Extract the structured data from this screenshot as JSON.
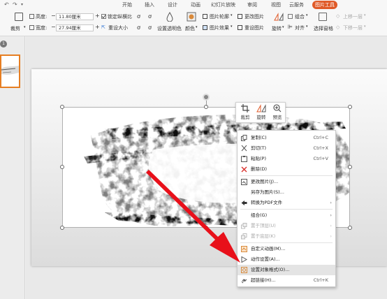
{
  "titlebar": {
    "quick_access": [
      "↶",
      "↷",
      "▾"
    ]
  },
  "tabs": [
    {
      "label": "开始"
    },
    {
      "label": "插入"
    },
    {
      "label": "设计"
    },
    {
      "label": "动画"
    },
    {
      "label": "幻灯片放映"
    },
    {
      "label": "审阅"
    },
    {
      "label": "视图"
    },
    {
      "label": "云服务"
    },
    {
      "label": "图片工具"
    }
  ],
  "ribbon": {
    "crop_label": "裁剪",
    "height_label": "高度:",
    "height_value": "11.80厘米",
    "width_label": "宽度:",
    "width_value": "27.94厘米",
    "lock_ratio_label": "锁定纵横比",
    "reset_size_label": "重设大小",
    "transparent_label": "设置透明色",
    "color_label": "颜色",
    "outline_label": "图片轮廓",
    "effect_label": "图片效果",
    "change_picture_label": "更改图片",
    "reset_picture_label": "重设图片",
    "rotate_label": "旋转",
    "group_label": "组合",
    "align_label": "对齐",
    "selection_pane_label": "选择窗格",
    "bring_forward_label": "上移一层",
    "send_backward_label": "下移一层"
  },
  "thumbnail": {
    "badge": "1"
  },
  "minibar": {
    "crop": "裁剪",
    "rotate": "旋转",
    "preview": "预览"
  },
  "context_menu": {
    "items": [
      {
        "label": "复制(C)",
        "shortcut": "Ctrl+C",
        "icon": "copy-icon"
      },
      {
        "label": "剪切(T)",
        "shortcut": "Ctrl+X",
        "icon": "cut-icon"
      },
      {
        "label": "粘贴(P)",
        "shortcut": "Ctrl+V",
        "icon": "paste-icon"
      },
      {
        "label": "删除(D)",
        "shortcut": "",
        "icon": "delete-icon"
      },
      {
        "label": "更改图片(J)...",
        "shortcut": "",
        "icon": "change-picture-icon"
      },
      {
        "label": "另存为图片(S)...",
        "shortcut": "",
        "icon": ""
      },
      {
        "label": "转换为PDF文件",
        "shortcut": "",
        "icon": "pdf-icon"
      },
      {
        "label": "组合(G)",
        "shortcut": "",
        "icon": ""
      },
      {
        "label": "置于顶层(U)",
        "shortcut": "",
        "icon": "bring-to-front-icon"
      },
      {
        "label": "置于底层(K)",
        "shortcut": "",
        "icon": "send-to-back-icon"
      },
      {
        "label": "自定义动画(M)...",
        "shortcut": "",
        "icon": "custom-animation-icon"
      },
      {
        "label": "动作设置(A)...",
        "shortcut": "",
        "icon": "action-icon"
      },
      {
        "label": "设置对象格式(O)...",
        "shortcut": "",
        "icon": "format-object-icon"
      },
      {
        "label": "超链接(H)...",
        "shortcut": "Ctrl+K",
        "icon": "hyperlink-icon"
      }
    ]
  },
  "colors": {
    "accent": "#e05a28",
    "arrow": "#e8101a",
    "selection": "#e67e22"
  }
}
